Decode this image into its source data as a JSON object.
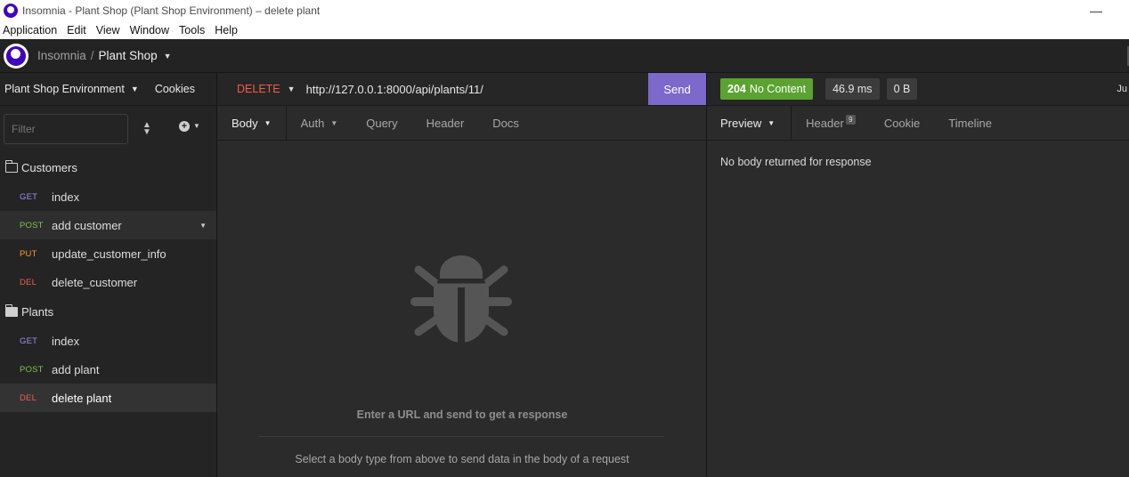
{
  "window": {
    "title": "Insomnia - Plant Shop (Plant Shop Environment) – delete plant",
    "minimize": "—"
  },
  "menu": [
    "Application",
    "Edit",
    "View",
    "Window",
    "Tools",
    "Help"
  ],
  "header": {
    "root": "Insomnia",
    "separator": "/",
    "workspace": "Plant Shop"
  },
  "sidebar": {
    "environment": "Plant Shop Environment",
    "cookies": "Cookies",
    "filter_placeholder": "Filter",
    "folders": [
      {
        "name": "Customers",
        "requests": [
          {
            "method": "GET",
            "name": "index"
          },
          {
            "method": "POST",
            "name": "add customer"
          },
          {
            "method": "PUT",
            "name": "update_customer_info"
          },
          {
            "method": "DEL",
            "name": "delete_customer"
          }
        ]
      },
      {
        "name": "Plants",
        "requests": [
          {
            "method": "GET",
            "name": "index"
          },
          {
            "method": "POST",
            "name": "add plant"
          },
          {
            "method": "DEL",
            "name": "delete plant"
          }
        ]
      }
    ]
  },
  "request": {
    "method": "DELETE",
    "url": "http://127.0.0.1:8000/api/plants/11/",
    "send": "Send",
    "tabs": [
      "Body",
      "Auth",
      "Query",
      "Header",
      "Docs"
    ],
    "hint_main": "Enter a URL and send to get a response",
    "hint_sub": "Select a body type from above to send data in the body of a request"
  },
  "response": {
    "status_code": "204",
    "status_text": "No Content",
    "time": "46.9 ms",
    "size": "0 B",
    "cut_label": "Ju",
    "tabs": [
      "Preview",
      "Header",
      "Cookie",
      "Timeline"
    ],
    "header_count": "9",
    "empty_message": "No body returned for response"
  },
  "colors": {
    "accent": "#7d69cb",
    "status_ok": "#5aa330",
    "get": "#9d8df1",
    "post": "#7ec44a",
    "put": "#ff9a1f",
    "del": "#f05e4a"
  }
}
